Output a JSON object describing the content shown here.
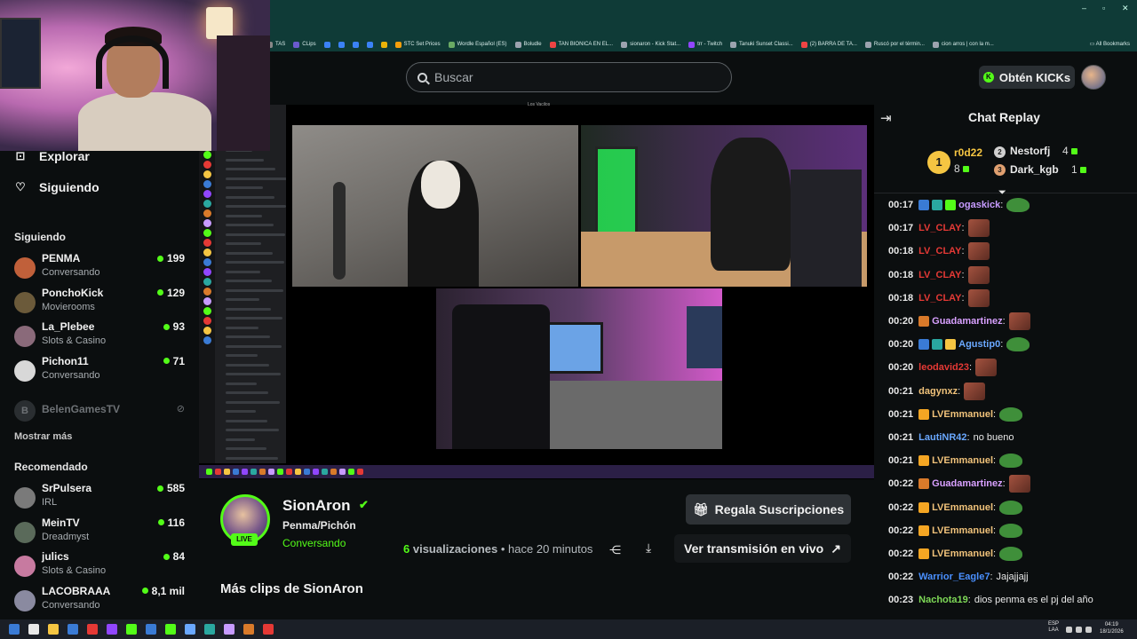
{
  "browser": {
    "bookmarks": [
      {
        "label": "TAS",
        "color": "#888888"
      },
      {
        "label": "CLips",
        "color": "#6a5acd"
      },
      {
        "label": "",
        "color": "#3b82f6"
      },
      {
        "label": "",
        "color": "#3b82f6"
      },
      {
        "label": "",
        "color": "#3b82f6"
      },
      {
        "label": "",
        "color": "#3b82f6"
      },
      {
        "label": "",
        "color": "#eab308"
      },
      {
        "label": "STC Set Prices",
        "color": "#f59e0b"
      },
      {
        "label": "Wordle Español (ES)",
        "color": "#6aaa64"
      },
      {
        "label": "Boludle",
        "color": "#9ca3af"
      },
      {
        "label": "TAN BIONICA EN EL...",
        "color": "#ef4444"
      },
      {
        "label": "sionaron - Kick Stat...",
        "color": "#9ca3af"
      },
      {
        "label": "trr - Twitch",
        "color": "#9146ff"
      },
      {
        "label": "Tanuki Sunset Classi...",
        "color": "#9ca3af"
      },
      {
        "label": "(2) BARRA DE TA...",
        "color": "#ef4444"
      },
      {
        "label": "Ruscó por el términ...",
        "color": "#9ca3af"
      },
      {
        "label": "cion arros | con la m...",
        "color": "#9ca3af"
      }
    ],
    "all_bookmarks_label": "All Bookmarks"
  },
  "header": {
    "search_placeholder": "Buscar",
    "kicks_button_label": "Obtén KICKs",
    "kicks_icon": "K"
  },
  "sidebar": {
    "nav": [
      {
        "label": "Explorar",
        "icon": "explore-icon",
        "glyph": "⊡"
      },
      {
        "label": "Siguiendo",
        "icon": "heart-icon",
        "glyph": "♡"
      }
    ],
    "following_heading": "Siguiendo",
    "following": [
      {
        "name": "PENMA",
        "category": "Conversando",
        "viewers": "199",
        "avatar_color": "#c0603a"
      },
      {
        "name": "PonchoKick",
        "category": "Movierooms",
        "viewers": "129",
        "avatar_color": "#6b5a3a"
      },
      {
        "name": "La_Plebee",
        "category": "Slots & Casino",
        "viewers": "93",
        "avatar_color": "#8a6a7a"
      },
      {
        "name": "Pichon11",
        "category": "Conversando",
        "viewers": "71",
        "avatar_color": "#d8d8d8"
      }
    ],
    "offline_channel": {
      "name": "BelenGamesTV",
      "initial": "B"
    },
    "show_more": "Mostrar más",
    "recommended_heading": "Recomendado",
    "recommended": [
      {
        "name": "SrPulsera",
        "category": "IRL",
        "viewers": "585",
        "avatar_color": "#7a7a7a"
      },
      {
        "name": "MeinTV",
        "category": "Dreadmyst",
        "viewers": "116",
        "avatar_color": "#5a6a5a"
      },
      {
        "name": "julics",
        "category": "Slots & Casino",
        "viewers": "84",
        "avatar_color": "#c77aa0"
      },
      {
        "name": "LACOBRAAA",
        "category": "Conversando",
        "viewers": "8,1 mil",
        "avatar_color": "#8a8aa0"
      }
    ]
  },
  "video": {
    "discord_call_title": "Los Vacilos"
  },
  "clip": {
    "channel_name": "SionAron",
    "live_badge": "LIVE",
    "title": "Penma/Pichón",
    "category": "Conversando",
    "views_count": "6",
    "views_label": "visualizaciones",
    "time_ago": "• hace 20 minutos",
    "gift_button_label": "Regala Suscripciones",
    "watch_live_label": "Ver transmisión en vivo",
    "more_clips": "Más clips de SionAron"
  },
  "chat": {
    "title": "Chat Replay",
    "leaderboard": [
      {
        "rank": "1",
        "name": "r0d22",
        "count": "8",
        "color": "#f5c542"
      },
      {
        "rank": "2",
        "name": "Nestorfj",
        "count": "4",
        "color": "#d0d0d0"
      },
      {
        "rank": "3",
        "name": "Dark_kgb",
        "count": "1",
        "color": "#e0a070"
      }
    ],
    "messages": [
      {
        "time": "00:17",
        "user": "ogaskick",
        "color": "#c79bff",
        "badges": [
          "#3a7bd5",
          "#2aa7a0",
          "#53fc18"
        ],
        "text": "",
        "emote": "pepe"
      },
      {
        "time": "00:17",
        "user": "LV_CLAY",
        "color": "#e53935",
        "badges": [],
        "text": "",
        "emote": "face"
      },
      {
        "time": "00:18",
        "user": "LV_CLAY",
        "color": "#e53935",
        "badges": [],
        "text": "",
        "emote": "face"
      },
      {
        "time": "00:18",
        "user": "LV_CLAY",
        "color": "#e53935",
        "badges": [],
        "text": "",
        "emote": "face"
      },
      {
        "time": "00:18",
        "user": "LV_CLAY",
        "color": "#e53935",
        "badges": [],
        "text": "",
        "emote": "face"
      },
      {
        "time": "00:20",
        "user": "Guadamartinez",
        "color": "#d8a0ff",
        "badges": [
          "#d97a2a"
        ],
        "text": "",
        "emote": "face"
      },
      {
        "time": "00:20",
        "user": "Agustip0",
        "color": "#6aa8ff",
        "badges": [
          "#3a7bd5",
          "#2aa7a0",
          "#f5c542"
        ],
        "text": "",
        "emote": "pepe"
      },
      {
        "time": "00:20",
        "user": "leodavid23",
        "color": "#e53935",
        "badges": [],
        "text": "",
        "emote": "face"
      },
      {
        "time": "00:21",
        "user": "dagynxz",
        "color": "#f0c27a",
        "badges": [],
        "text": "",
        "emote": "face"
      },
      {
        "time": "00:21",
        "user": "LVEmmanuel",
        "color": "#f0c27a",
        "badges": [
          "#f5a623"
        ],
        "text": "",
        "emote": "pepe"
      },
      {
        "time": "00:21",
        "user": "LautiNR42",
        "color": "#6aa8ff",
        "badges": [],
        "text": "no bueno",
        "emote": ""
      },
      {
        "time": "00:21",
        "user": "LVEmmanuel",
        "color": "#f0c27a",
        "badges": [
          "#f5a623"
        ],
        "text": "",
        "emote": "pepe"
      },
      {
        "time": "00:22",
        "user": "Guadamartinez",
        "color": "#d8a0ff",
        "badges": [
          "#d97a2a"
        ],
        "text": "",
        "emote": "face"
      },
      {
        "time": "00:22",
        "user": "LVEmmanuel",
        "color": "#f0c27a",
        "badges": [
          "#f5a623"
        ],
        "text": "",
        "emote": "pepe"
      },
      {
        "time": "00:22",
        "user": "LVEmmanuel",
        "color": "#f0c27a",
        "badges": [
          "#f5a623"
        ],
        "text": "",
        "emote": "pepe"
      },
      {
        "time": "00:22",
        "user": "LVEmmanuel",
        "color": "#f0c27a",
        "badges": [
          "#f5a623"
        ],
        "text": "",
        "emote": "pepe"
      },
      {
        "time": "00:22",
        "user": "Warrior_Eagle7",
        "color": "#4a90ff",
        "badges": [],
        "text": "Jajajjajj",
        "emote": ""
      },
      {
        "time": "00:23",
        "user": "Nachota19",
        "color": "#7ed957",
        "badges": [],
        "text": "dios penma es el pj del año",
        "emote": ""
      }
    ]
  },
  "system": {
    "lang_line1": "ESP",
    "lang_line2": "LAA",
    "clock_time": "04:19",
    "clock_date": "18/1/2026"
  },
  "colors": {
    "brand_green": "#53fc18",
    "background": "#0b0e0f",
    "browser_chrome": "#0f3b37"
  }
}
